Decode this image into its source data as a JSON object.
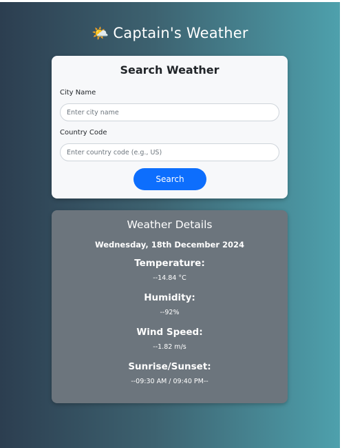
{
  "app": {
    "title": "Captain's Weather",
    "title_icon": "sun-behind-cloud-icon"
  },
  "search": {
    "heading": "Search Weather",
    "city_label": "City Name",
    "city_placeholder": "Enter city name",
    "city_value": "",
    "country_label": "Country Code",
    "country_placeholder": "Enter country code (e.g., US)",
    "country_value": "",
    "button_label": "Search",
    "button_color": "#0d6efd"
  },
  "details": {
    "heading": "Weather Details",
    "date": "Wednesday, 18th December 2024",
    "temperature_label": "Temperature:",
    "temperature_value": "--14.84 °C",
    "humidity_label": "Humidity:",
    "humidity_value": "--92%",
    "wind_label": "Wind Speed:",
    "wind_value": "--1.82 m/s",
    "sun_label": "Sunrise/Sunset:",
    "sun_value": "--09:30 AM / 09:40 PM--",
    "card_color": "#6c757d"
  },
  "theme": {
    "gradient_start": "#2c3e50",
    "gradient_end": "#4ea1ad"
  }
}
